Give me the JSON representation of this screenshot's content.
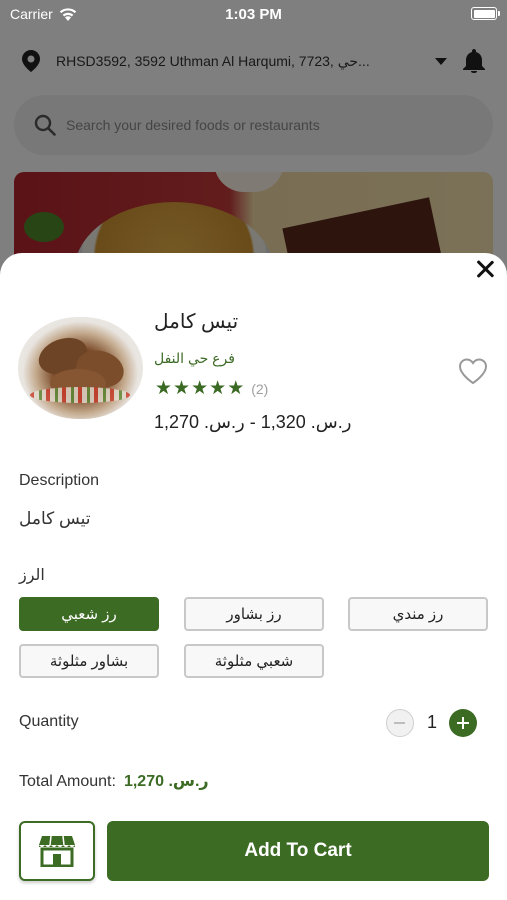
{
  "status_bar": {
    "carrier": "Carrier",
    "time": "1:03 PM"
  },
  "header": {
    "address": "RHSD3592, 3592 Uthman Al Harqumi, 7723, حي..."
  },
  "search": {
    "placeholder": "Search your desired foods or restaurants"
  },
  "product": {
    "name": "تيس كامل",
    "branch": "فرع حي النفل",
    "rating": 5,
    "reviews_label": "(2)",
    "price": "ر.س. 1,320 - ر.س. 1,270"
  },
  "description": {
    "label": "Description",
    "text": "تيس كامل"
  },
  "option_group": {
    "label": "الرز",
    "options": [
      {
        "label": "رز شعبي",
        "selected": true
      },
      {
        "label": "رز بشاور",
        "selected": false
      },
      {
        "label": "رز مندي",
        "selected": false
      },
      {
        "label": "بشاور مثلوثة",
        "selected": false
      },
      {
        "label": "شعبي مثلوثة",
        "selected": false
      }
    ]
  },
  "quantity": {
    "label": "Quantity",
    "value": "1"
  },
  "total": {
    "label": "Total Amount:",
    "value": "ر.س. 1,270"
  },
  "actions": {
    "add_to_cart": "Add To Cart"
  },
  "colors": {
    "brand_green": "#3c6b24",
    "star_green": "#3a6a23"
  },
  "icons": [
    "wifi-icon",
    "battery-icon",
    "location-pin-icon",
    "chevron-down-icon",
    "bell-icon",
    "search-icon",
    "close-icon",
    "heart-icon",
    "star-icon",
    "minus-icon",
    "plus-icon",
    "store-icon"
  ]
}
